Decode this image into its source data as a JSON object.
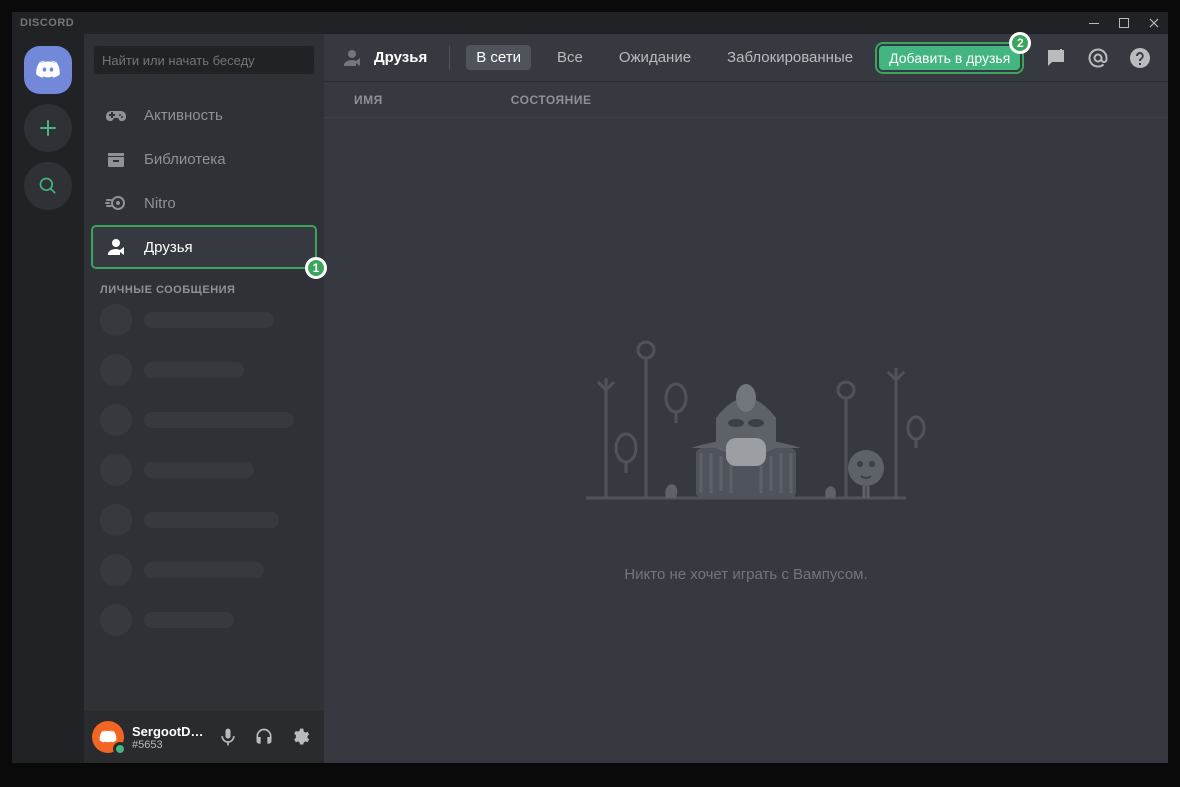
{
  "titlebar": {
    "brand": "DISCORD"
  },
  "sidebar": {
    "search_placeholder": "Найти или начать беседу",
    "nav": [
      {
        "label": "Активность",
        "icon": "gamepad"
      },
      {
        "label": "Библиотека",
        "icon": "library"
      },
      {
        "label": "Nitro",
        "icon": "nitro"
      },
      {
        "label": "Друзья",
        "icon": "friends"
      }
    ],
    "dm_header": "ЛИЧНЫЕ СООБЩЕНИЯ"
  },
  "user": {
    "name": "SergootDis...",
    "tag": "#5653"
  },
  "topbar": {
    "title": "Друзья",
    "tabs": {
      "online": "В сети",
      "all": "Все",
      "pending": "Ожидание",
      "blocked": "Заблокированные"
    },
    "add_friend": "Добавить в друзья"
  },
  "columns": {
    "name": "ИМЯ",
    "status": "СОСТОЯНИЕ"
  },
  "empty_state": "Никто не хочет играть с Вампусом.",
  "callouts": {
    "one": "1",
    "two": "2"
  }
}
